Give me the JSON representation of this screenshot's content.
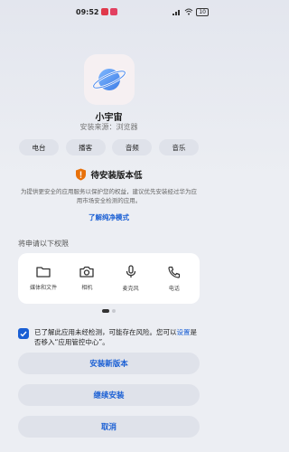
{
  "status_bar": {
    "time": "09:52",
    "battery": "10",
    "signal_icon": "signal-icon",
    "wifi_icon": "wifi-icon"
  },
  "app": {
    "name": "小宇宙",
    "source": "安装来源：浏览器",
    "icon": "planet-icon",
    "tags": [
      "电台",
      "播客",
      "音频",
      "音乐"
    ]
  },
  "warning": {
    "icon": "warning-shield-icon",
    "title": "待安装版本低",
    "description": "为提供更安全的应用服务以保护您的权益，建议优先安装经过华为应用市场安全检测的应用。",
    "link": "了解纯净模式"
  },
  "permissions": {
    "title": "将申请以下权限",
    "items": [
      {
        "label": "媒体和文件",
        "icon": "folder-icon"
      },
      {
        "label": "相机",
        "icon": "camera-icon"
      },
      {
        "label": "麦克风",
        "icon": "microphone-icon"
      },
      {
        "label": "电话",
        "icon": "phone-icon"
      }
    ]
  },
  "consent": {
    "checked": true,
    "text_before": "已了解此应用未经检测，可能存在风险。您可以",
    "link": "设置",
    "text_after": "是否移入“应用管控中心”。"
  },
  "buttons": {
    "install_new": "安装新版本",
    "continue_install": "继续安装",
    "cancel": "取消"
  },
  "colors": {
    "accent": "#1a5fd4",
    "warning": "#e8710a"
  }
}
